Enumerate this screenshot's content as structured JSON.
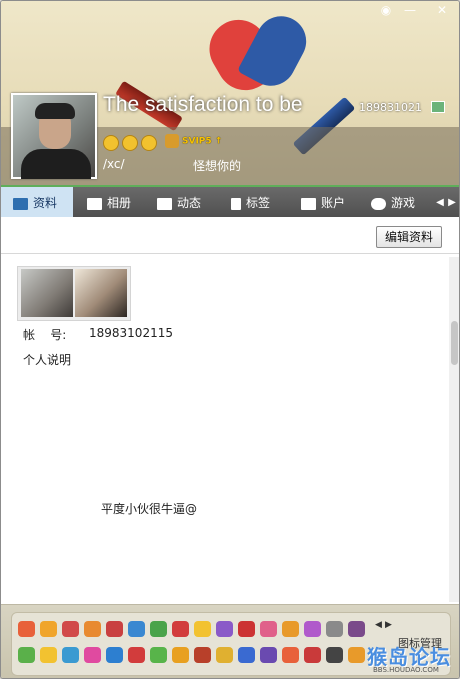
{
  "header": {
    "nickname": "The satisfaction to be",
    "account_short": "189831021",
    "signature_part1": "/xc/",
    "signature_part2": "怪想你的",
    "svip_label": "SVIP5",
    "window_controls": [
      "skin",
      "minimize",
      "close"
    ]
  },
  "tabs": [
    {
      "label": "资料",
      "icon": "profile-card-icon",
      "active": true
    },
    {
      "label": "相册",
      "icon": "album-icon",
      "active": false
    },
    {
      "label": "动态",
      "icon": "feed-icon",
      "active": false
    },
    {
      "label": "标签",
      "icon": "bookmark-icon",
      "active": false
    },
    {
      "label": "账户",
      "icon": "wallet-icon",
      "active": false
    },
    {
      "label": "游戏",
      "icon": "game-icon",
      "active": false
    }
  ],
  "toolbar": {
    "edit_label": "编辑资料"
  },
  "profile": {
    "account_label": "帐    号:",
    "account_value": "18983102115",
    "description_label": "个人说明",
    "description_text": "平度小伙很牛逼@"
  },
  "footer": {
    "icon_manager_label": "图标管理",
    "watermark": "猴岛论坛",
    "watermark_sub": "BBS.HOUDAO.COM"
  },
  "colors": {
    "tab_bar": "#555555",
    "tab_active": "#cfe3f3",
    "accent_green": "#5fae5a",
    "heart_red": "#e0413c",
    "heart_blue": "#2e5aa6"
  }
}
